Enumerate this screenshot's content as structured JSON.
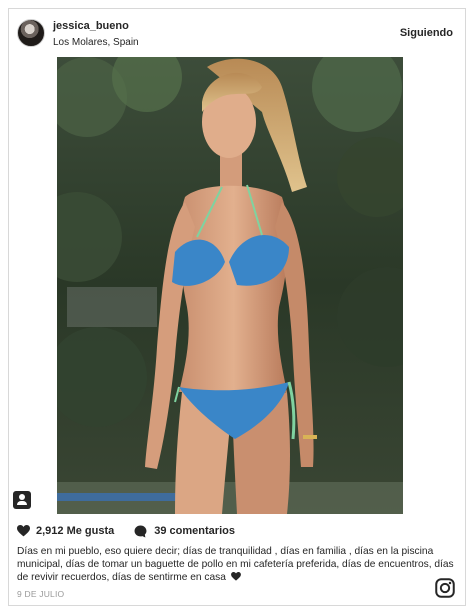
{
  "post": {
    "username": "jessica_bueno",
    "location": "Los Molares, Spain",
    "follow_label": "Siguiendo",
    "likes": "2,912 Me gusta",
    "comments": "39 comentarios",
    "caption": "Días en mi pueblo, eso quiere decir; días de tranquilidad , días en familia , días en la piscina municipal, días de tomar un baguette de pollo en mi cafetería preferida, días de encuentros, días de revivir recuerdos, días de sentirme en casa",
    "date": "9 DE JULIO"
  },
  "icons": {
    "like": "heart-icon",
    "comment": "comment-icon",
    "tag": "person-tag-icon",
    "brand": "instagram-icon",
    "caption_emoji": "black-heart-emoji"
  },
  "colors": {
    "text": "#262626",
    "muted": "#999999",
    "border": "#d8d8d8",
    "bikini": "#3a86c8",
    "tie": "#7fd3a0"
  }
}
